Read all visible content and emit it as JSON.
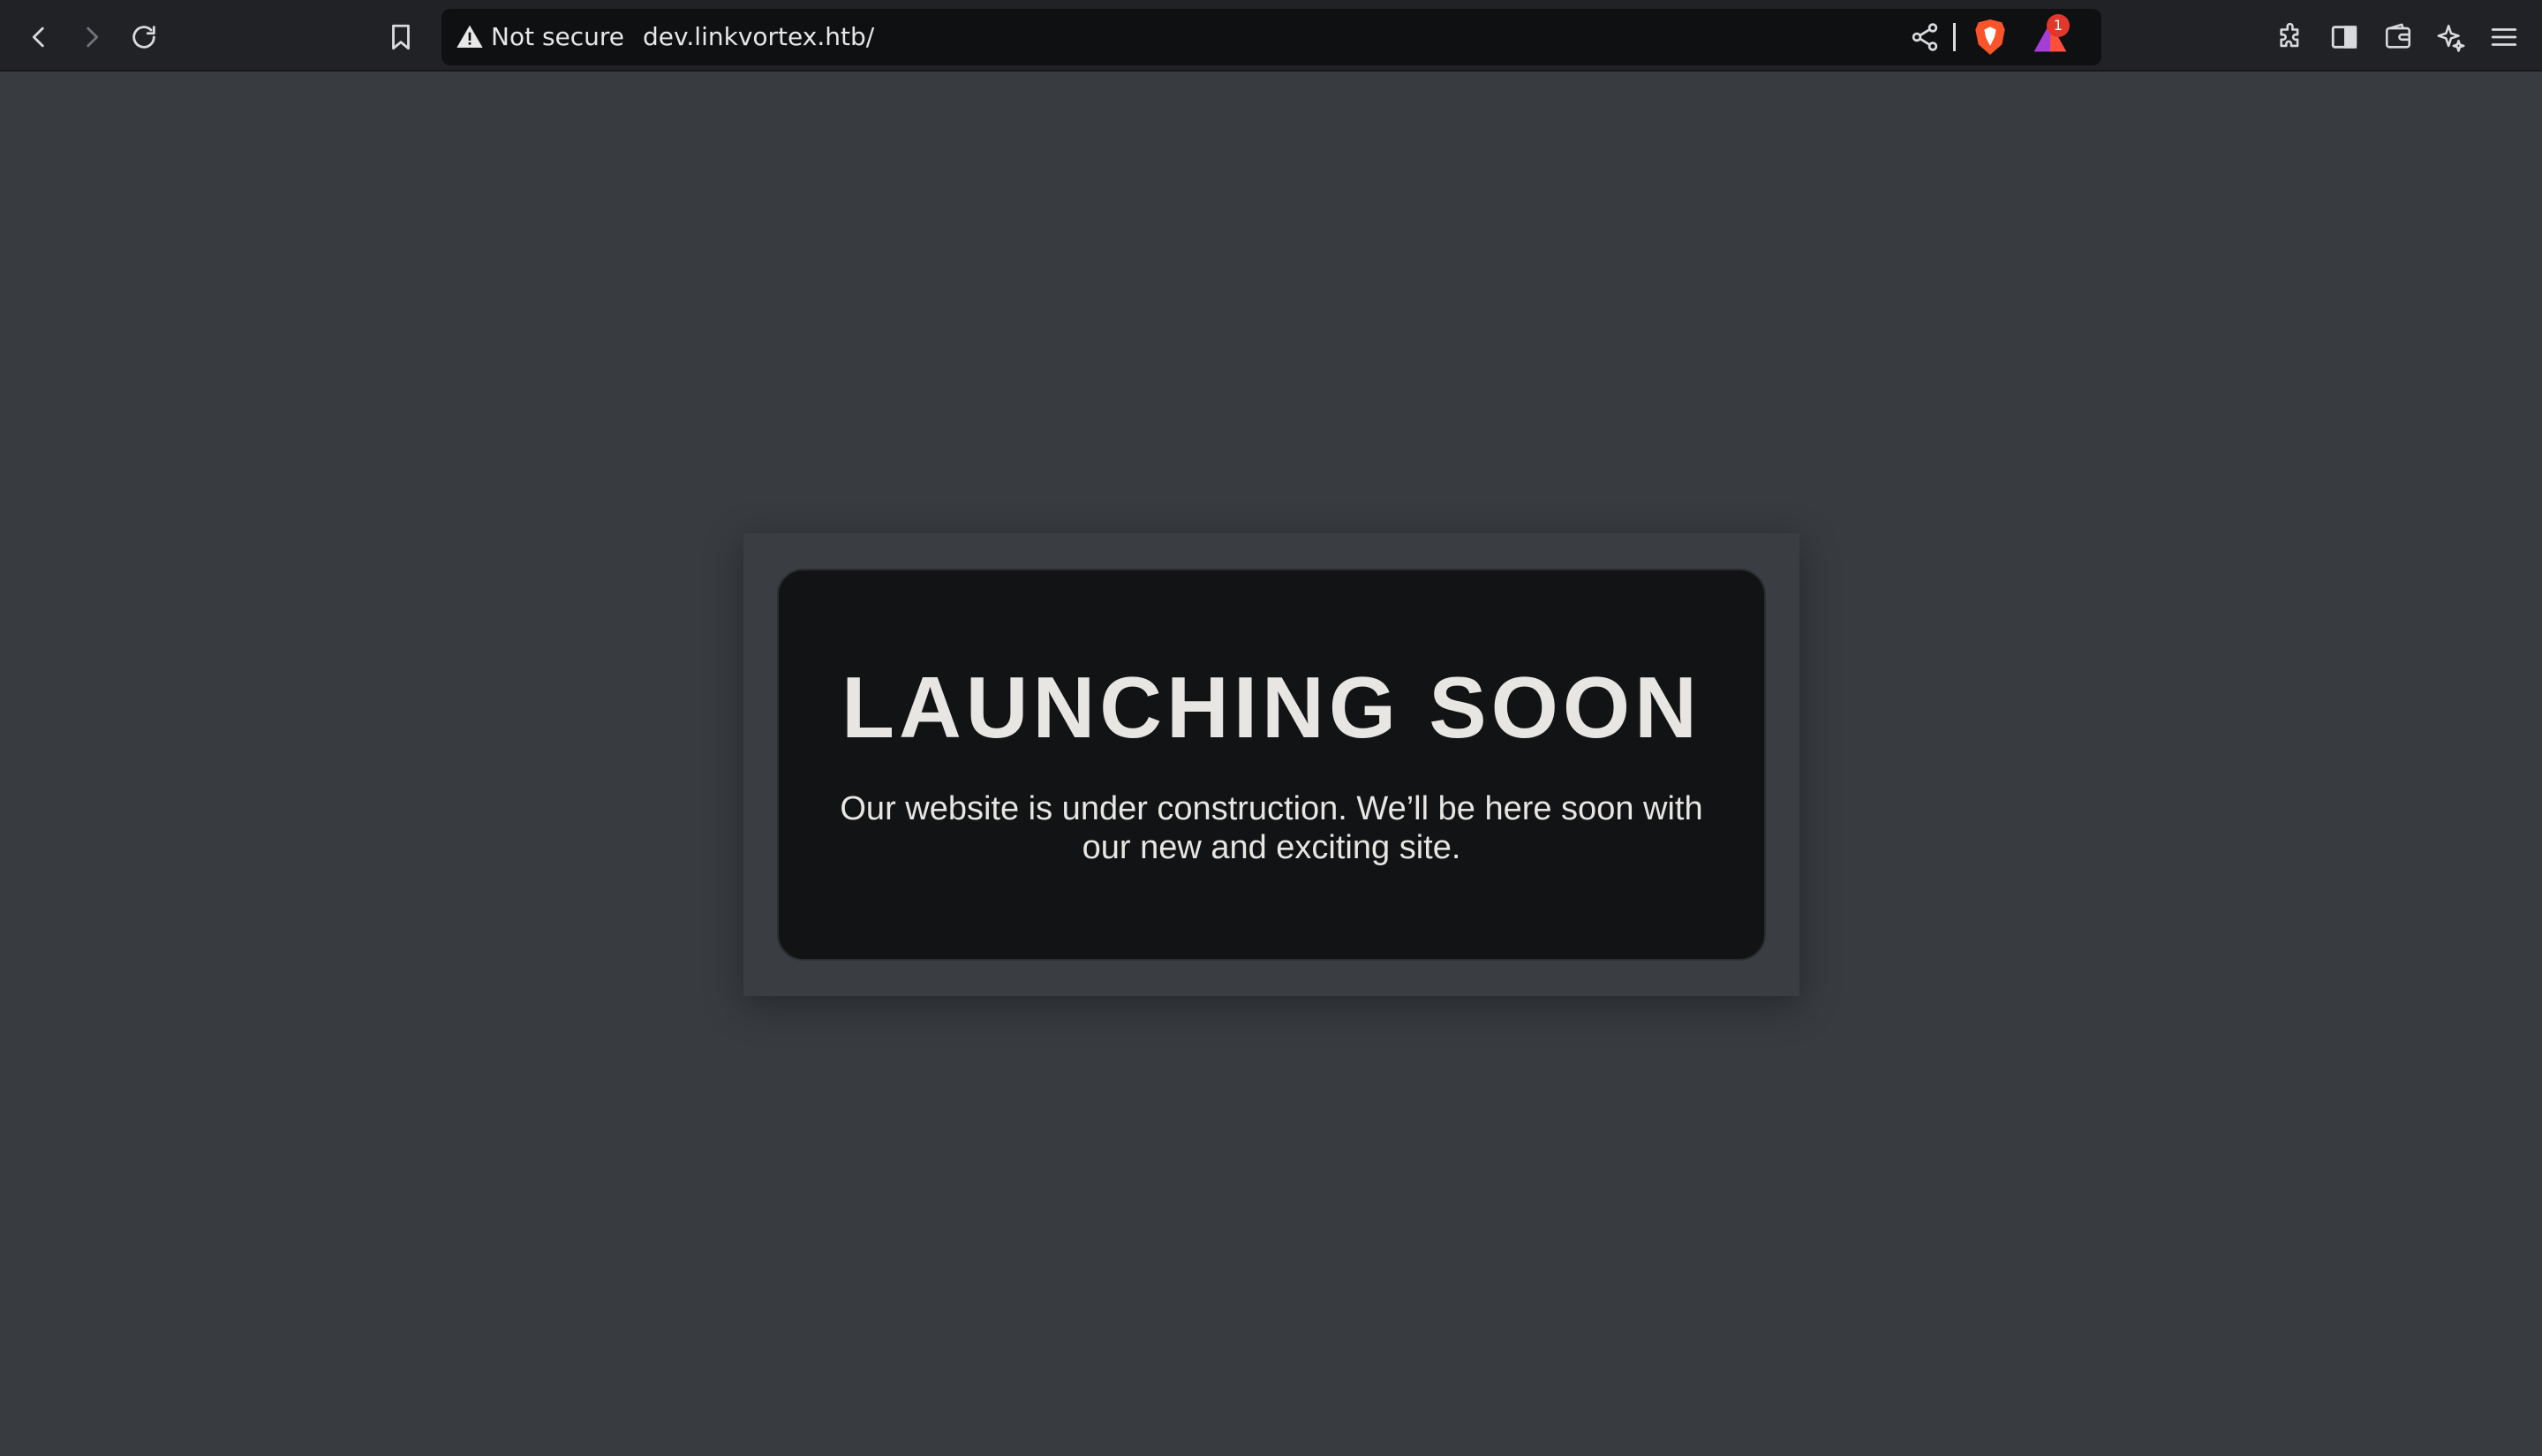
{
  "browser": {
    "security_label": "Not secure",
    "url": "dev.linkvortex.htb/",
    "rewards_badge": "1",
    "icons": {
      "back": "back-arrow-icon",
      "forward": "forward-arrow-icon",
      "reload": "reload-icon",
      "bookmark": "bookmark-icon",
      "security": "warning-icon",
      "share": "share-icon",
      "brave_shields": "brave-shields-icon",
      "rewards": "brave-rewards-icon",
      "extensions": "extensions-icon",
      "sidebar": "sidebar-icon",
      "wallet": "wallet-icon",
      "leo": "leo-ai-icon",
      "menu": "menu-icon"
    }
  },
  "page": {
    "title": "LAUNCHING SOON",
    "message": "Our website is under construction. We’ll be here soon with our new and exciting site."
  },
  "colors": {
    "page_background": "#383c40",
    "card_background": "#121315",
    "text": "#e8e6e3",
    "toolbar": "#202226",
    "brave_orange": "#fb542b",
    "badge_red": "#e2382c"
  }
}
